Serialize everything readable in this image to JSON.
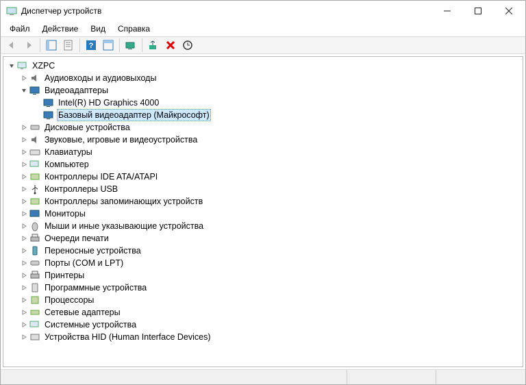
{
  "window": {
    "title": "Диспетчер устройств"
  },
  "menu": {
    "file": "Файл",
    "action": "Действие",
    "view": "Вид",
    "help": "Справка"
  },
  "tree": {
    "root": "XZPC",
    "audio": "Аудиовходы и аудиовыходы",
    "video": "Видеоадаптеры",
    "video_child_0": "Intel(R) HD Graphics 4000",
    "video_child_1": "Базовый видеоадаптер (Майкрософт)",
    "disk": "Дисковые устройства",
    "sound": "Звуковые, игровые и видеоустройства",
    "keyboards": "Клавиатуры",
    "computer": "Компьютер",
    "ide": "Контроллеры IDE ATA/ATAPI",
    "usb": "Контроллеры USB",
    "storage_ctrl": "Контроллеры запоминающих устройств",
    "monitors": "Мониторы",
    "mouse": "Мыши и иные указывающие устройства",
    "print_queue": "Очереди печати",
    "portable": "Переносные устройства",
    "ports": "Порты (COM и LPT)",
    "printers": "Принтеры",
    "software": "Программные устройства",
    "cpu": "Процессоры",
    "network": "Сетевые адаптеры",
    "system": "Системные устройства",
    "hid": "Устройства HID (Human Interface Devices)"
  }
}
